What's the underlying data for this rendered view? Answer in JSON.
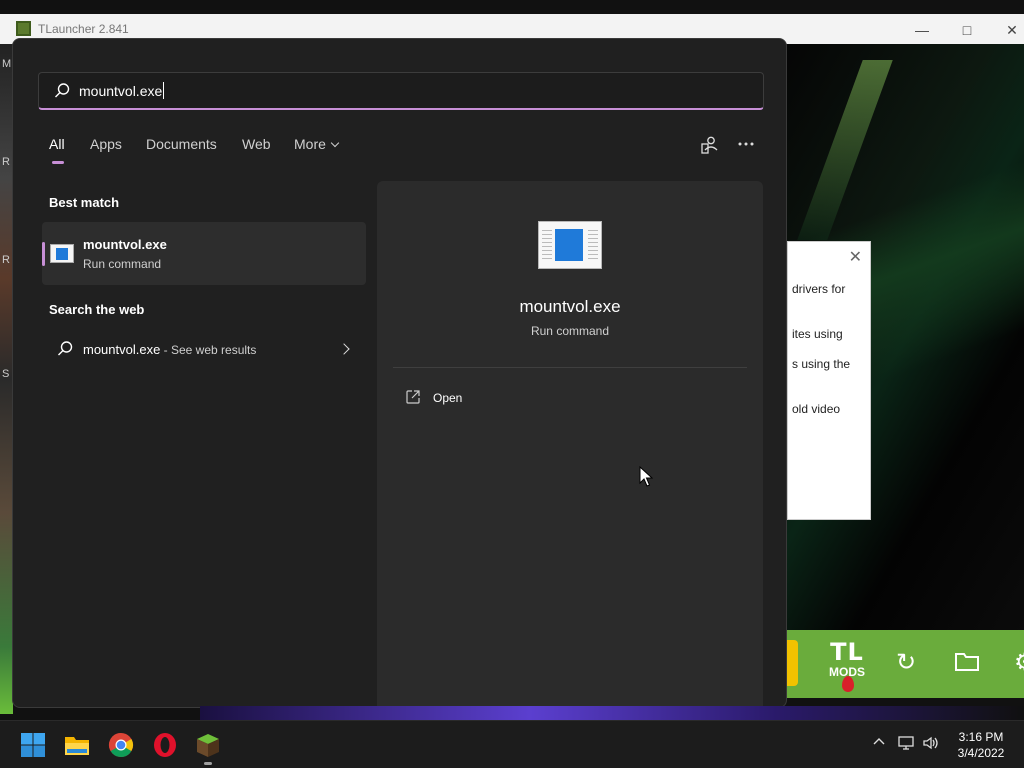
{
  "background": {
    "window_title": "TLauncher 2.841",
    "left_letters": [
      "M",
      "R",
      "R",
      "S"
    ],
    "dialog_lines": [
      "drivers for",
      "ites using",
      "s using the",
      "old video"
    ],
    "brand_top": "TL",
    "brand_bottom": "MODS"
  },
  "search": {
    "query": "mountvol.exe",
    "tabs": [
      {
        "label": "All",
        "active": true
      },
      {
        "label": "Apps"
      },
      {
        "label": "Documents"
      },
      {
        "label": "Web"
      },
      {
        "label": "More"
      }
    ]
  },
  "results": {
    "best_match_title": "Best match",
    "best_match": {
      "name": "mountvol.exe",
      "type": "Run command"
    },
    "web_title": "Search the web",
    "web_result": {
      "query": "mountvol.exe",
      "suffix": " - See web results"
    }
  },
  "detail": {
    "name": "mountvol.exe",
    "type": "Run command",
    "actions": [
      {
        "label": "Open"
      }
    ]
  },
  "taskbar": {
    "time": "3:16 PM",
    "date": "3/4/2022",
    "pinned": [
      "windows-start-icon",
      "file-explorer-icon",
      "chrome-icon",
      "opera-icon",
      "tlauncher-icon"
    ]
  },
  "colors": {
    "accent": "#c78fd6",
    "panel_bg": "#202020",
    "detail_bg": "#2b2b2b",
    "launcher_green": "#6aac3c"
  }
}
